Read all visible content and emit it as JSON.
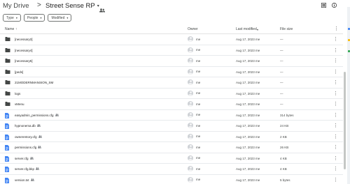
{
  "header": {
    "root": "My Drive",
    "separator": ">",
    "folder": "Street Sense RP",
    "caret": "▾",
    "shared_icon": "people-icon",
    "right_icons": [
      "grid-view-icon",
      "info-icon"
    ]
  },
  "filters": [
    {
      "label": "Type",
      "caret": "▾"
    },
    {
      "label": "People",
      "caret": "▾"
    },
    {
      "label": "Modified",
      "caret": "▾"
    }
  ],
  "columns": {
    "name": "Name",
    "sort_arrow": "↑",
    "owner": "Owner",
    "last_modified": "Last modified",
    "last_modified_arrow": "▾",
    "file_size": "File size",
    "more": "⋮"
  },
  "rows": [
    {
      "name": "[necessary3]",
      "type": "folder",
      "shared": false,
      "owner": "me",
      "modified": "Aug 17, 2023 me",
      "size": "—"
    },
    {
      "name": "[necessary4]",
      "type": "folder",
      "shared": false,
      "owner": "me",
      "modified": "Aug 17, 2023 me",
      "size": "—"
    },
    {
      "name": "[necessary5]",
      "type": "folder",
      "shared": false,
      "owner": "me",
      "modified": "Aug 17, 2023 me",
      "size": "—"
    },
    {
      "name": "[peds]",
      "type": "folder",
      "shared": false,
      "owner": "me",
      "modified": "Aug 17, 2023 me",
      "size": "—"
    },
    {
      "name": "21MODERNMANSION_SM",
      "type": "folder",
      "shared": false,
      "owner": "me",
      "modified": "Aug 17, 2023 me",
      "size": "—"
    },
    {
      "name": "logs",
      "type": "folder",
      "shared": false,
      "owner": "me",
      "modified": "Aug 17, 2023 me",
      "size": "—"
    },
    {
      "name": "vMenu",
      "type": "folder",
      "shared": false,
      "owner": "me",
      "modified": "Aug 17, 2023 me",
      "size": "—"
    },
    {
      "name": "easyadmin_permissions.cfg",
      "type": "file",
      "shared": true,
      "owner": "me",
      "modified": "Aug 17, 2023 me",
      "size": "314 bytes"
    },
    {
      "name": "hypnonema.db",
      "type": "file",
      "shared": true,
      "owner": "me",
      "modified": "Aug 17, 2023 me",
      "size": "24 KB"
    },
    {
      "name": "ownerentory.cfg",
      "type": "file",
      "shared": true,
      "owner": "me",
      "modified": "Aug 17, 2023 me",
      "size": "2 KB"
    },
    {
      "name": "permissions.cfg",
      "type": "file",
      "shared": true,
      "owner": "me",
      "modified": "Aug 17, 2023 me",
      "size": "26 KB"
    },
    {
      "name": "server.cfg",
      "type": "file",
      "shared": true,
      "owner": "me",
      "modified": "Aug 17, 2023 me",
      "size": "4 KB"
    },
    {
      "name": "server.cfg.bkp",
      "type": "file",
      "shared": true,
      "owner": "me",
      "modified": "Aug 17, 2023 me",
      "size": "4 KB"
    },
    {
      "name": "version.txt",
      "type": "file",
      "shared": true,
      "owner": "me",
      "modified": "Aug 17, 2023 me",
      "size": "5 bytes"
    }
  ],
  "colors": {
    "text": "#1f1f1f",
    "muted": "#444746",
    "divider": "#e8eaed",
    "folder_icon": "#444746",
    "file_icon": "#4285f4",
    "avatar": "#cfd2d6"
  }
}
